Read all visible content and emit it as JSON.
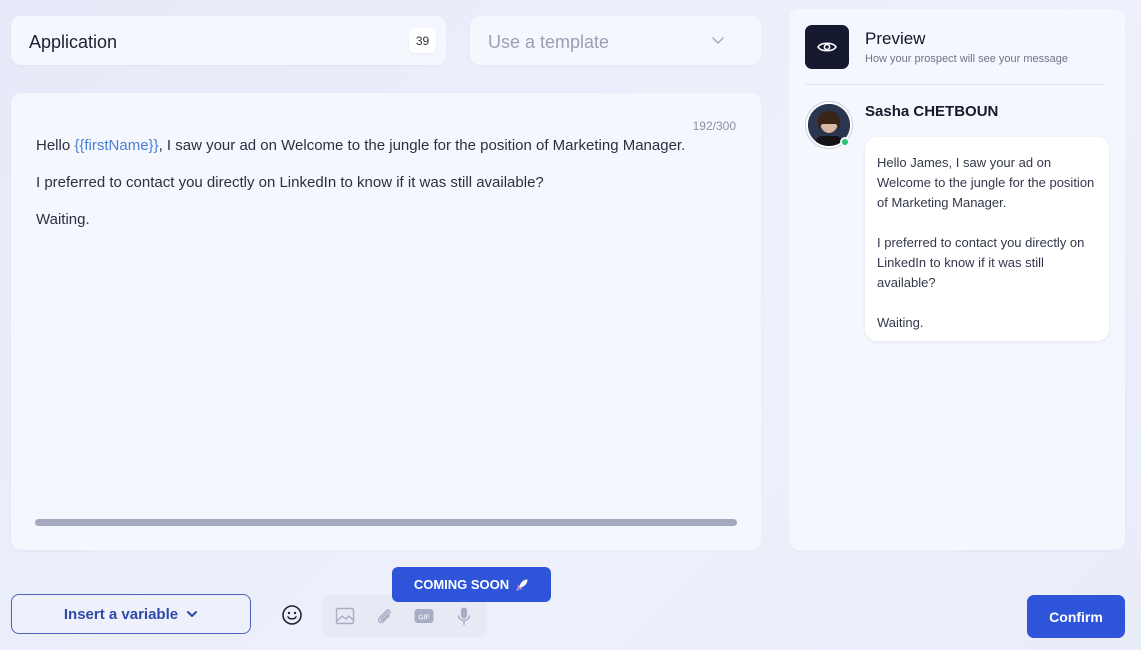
{
  "title_field": {
    "value": "Application",
    "char_count": "39"
  },
  "template_dropdown": {
    "placeholder": "Use a template",
    "icon": "chevron-down-icon"
  },
  "editor": {
    "counter": "192/300",
    "line1_before": "Hello ",
    "line1_variable": "{{firstName}}",
    "line1_after": ", I saw your ad on Welcome to the jungle for the position of Marketing Manager.",
    "line2": "I preferred to contact you directly on LinkedIn to know if it was still available?",
    "line3": "Waiting."
  },
  "preview": {
    "icon": "eye-icon",
    "title": "Preview",
    "subtitle": "How your prospect will see your message",
    "sender_name": "Sasha CHETBOUN",
    "bubble_p1": "Hello James, I saw your ad on Welcome to the jungle for the position of Marketing Manager.",
    "bubble_p2": "I preferred to contact you directly on LinkedIn to know if it was still available?",
    "bubble_p3": "Waiting."
  },
  "toolbar": {
    "insert_variable_label": "Insert a variable",
    "coming_soon_label": "COMING SOON",
    "confirm_label": "Confirm",
    "icons": [
      "smile-icon",
      "image-icon",
      "paperclip-icon",
      "gif-icon",
      "microphone-icon",
      "rocket-icon"
    ]
  },
  "colors": {
    "accent": "#2e55d9",
    "variable": "#4a7fd6",
    "online": "#2fbf71",
    "preview_icon_bg": "#151a31"
  }
}
